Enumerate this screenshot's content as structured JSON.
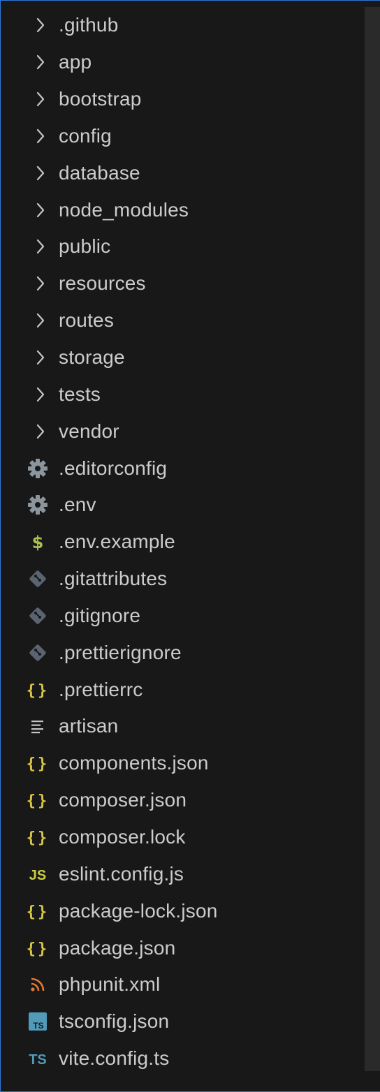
{
  "explorer": {
    "items": [
      {
        "label": ".github",
        "kind": "folder",
        "icon": "chevron-right-icon"
      },
      {
        "label": "app",
        "kind": "folder",
        "icon": "chevron-right-icon"
      },
      {
        "label": "bootstrap",
        "kind": "folder",
        "icon": "chevron-right-icon"
      },
      {
        "label": "config",
        "kind": "folder",
        "icon": "chevron-right-icon"
      },
      {
        "label": "database",
        "kind": "folder",
        "icon": "chevron-right-icon"
      },
      {
        "label": "node_modules",
        "kind": "folder",
        "icon": "chevron-right-icon"
      },
      {
        "label": "public",
        "kind": "folder",
        "icon": "chevron-right-icon"
      },
      {
        "label": "resources",
        "kind": "folder",
        "icon": "chevron-right-icon"
      },
      {
        "label": "routes",
        "kind": "folder",
        "icon": "chevron-right-icon"
      },
      {
        "label": "storage",
        "kind": "folder",
        "icon": "chevron-right-icon"
      },
      {
        "label": "tests",
        "kind": "folder",
        "icon": "chevron-right-icon"
      },
      {
        "label": "vendor",
        "kind": "folder",
        "icon": "chevron-right-icon"
      },
      {
        "label": ".editorconfig",
        "kind": "file",
        "icon": "gear-icon"
      },
      {
        "label": ".env",
        "kind": "file",
        "icon": "gear-icon"
      },
      {
        "label": ".env.example",
        "kind": "file",
        "icon": "dollar-icon"
      },
      {
        "label": ".gitattributes",
        "kind": "file",
        "icon": "git-icon"
      },
      {
        "label": ".gitignore",
        "kind": "file",
        "icon": "git-icon"
      },
      {
        "label": ".prettierignore",
        "kind": "file",
        "icon": "git-icon"
      },
      {
        "label": ".prettierrc",
        "kind": "file",
        "icon": "json-braces-icon"
      },
      {
        "label": "artisan",
        "kind": "file",
        "icon": "text-lines-icon"
      },
      {
        "label": "components.json",
        "kind": "file",
        "icon": "json-braces-icon"
      },
      {
        "label": "composer.json",
        "kind": "file",
        "icon": "json-braces-icon"
      },
      {
        "label": "composer.lock",
        "kind": "file",
        "icon": "json-braces-icon"
      },
      {
        "label": "eslint.config.js",
        "kind": "file",
        "icon": "js-icon"
      },
      {
        "label": "package-lock.json",
        "kind": "file",
        "icon": "json-braces-icon"
      },
      {
        "label": "package.json",
        "kind": "file",
        "icon": "json-braces-icon"
      },
      {
        "label": "phpunit.xml",
        "kind": "file",
        "icon": "rss-icon"
      },
      {
        "label": "tsconfig.json",
        "kind": "file",
        "icon": "ts-box-icon"
      },
      {
        "label": "vite.config.ts",
        "kind": "file",
        "icon": "ts-icon"
      }
    ],
    "icon_glyphs": {
      "dollar-icon": "$",
      "json-braces-icon": "{}",
      "js-icon": "JS",
      "ts-box-icon": "TS",
      "ts-icon": "TS"
    }
  },
  "colors": {
    "background": "#181818",
    "text": "#cccccc",
    "chevron": "#c5c5c5",
    "gear": "#8c949c",
    "dollar": "#a9c14f",
    "git": "#5a6470",
    "json": "#d6c545",
    "lines": "#c5c5c5",
    "js": "#cbcb41",
    "rss": "#e37933",
    "ts_box": "#519aba",
    "ts_text": "#519aba",
    "focus_border": "#2b79d8"
  }
}
